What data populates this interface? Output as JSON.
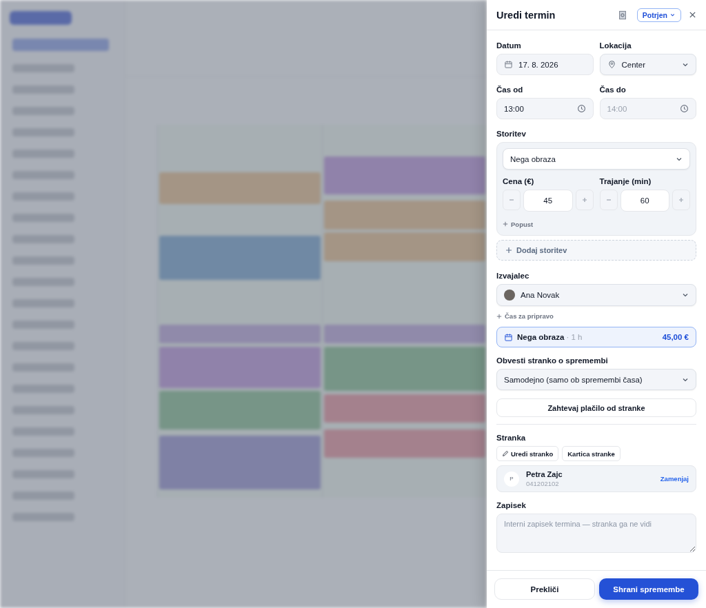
{
  "panel": {
    "title": "Uredi termin",
    "status": "Potrjen"
  },
  "date": {
    "label": "Datum",
    "value": "17. 8. 2026"
  },
  "location": {
    "label": "Lokacija",
    "value": "Center"
  },
  "time_from": {
    "label": "Čas od",
    "value": "13:00",
    "disabled": false
  },
  "time_to": {
    "label": "Čas do",
    "value": "14:00",
    "disabled": true
  },
  "service": {
    "label": "Storitev",
    "value": "Nega obraza",
    "price_label": "Cena (€)",
    "price": "45",
    "duration_label": "Trajanje (min)",
    "duration": "60",
    "discount_link": "Popust"
  },
  "add_service": "Dodaj storitev",
  "staff": {
    "label": "Izvajalec",
    "value": "Ana Novak"
  },
  "prep_time_link": "Čas za pripravo",
  "summary": {
    "name": "Nega obraza",
    "duration": "· 1 h",
    "price": "45,00 €"
  },
  "notify": {
    "label": "Obvesti stranko o spremembi",
    "value": "Samodejno (samo ob spremembi časa)"
  },
  "request_payment": "Zahtevaj plačilo od stranke",
  "client": {
    "label": "Stranka",
    "edit_button": "Uredi stranko",
    "card_button": "Kartica stranke",
    "initial": "P",
    "name": "Petra Zajc",
    "phone": "041202102",
    "replace": "Zamenjaj"
  },
  "note": {
    "label": "Zapisek",
    "placeholder": "Interni zapisek termina — stranka ga ne vidi"
  },
  "footer": {
    "cancel": "Prekliči",
    "save": "Shrani spremembe"
  }
}
